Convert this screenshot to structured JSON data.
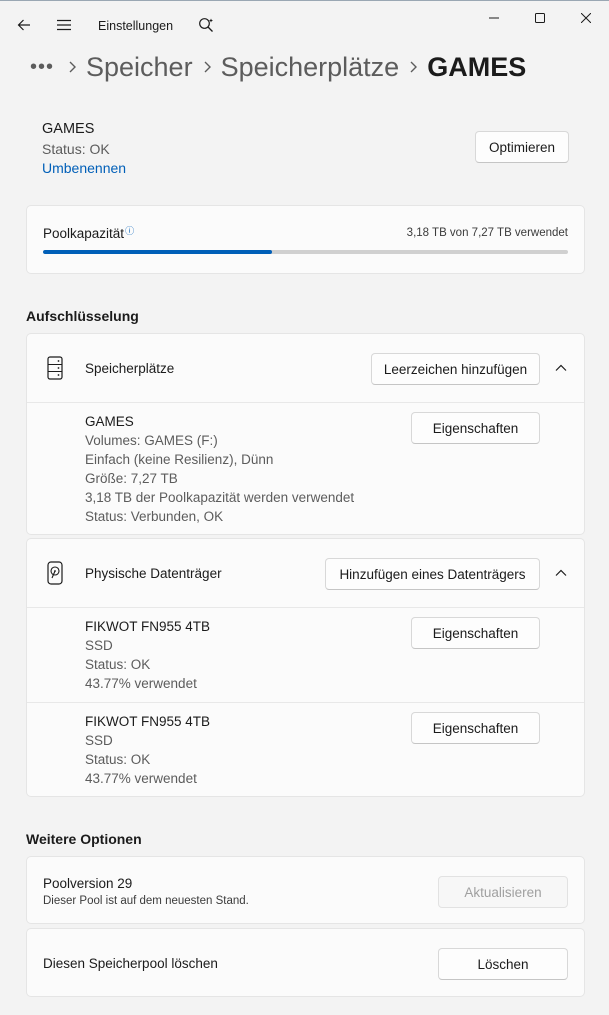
{
  "titlebar": {
    "app_title": "Einstellungen",
    "icons": {
      "back": "back-arrow-icon",
      "menu": "hamburger-menu-icon",
      "search": "search-icon",
      "minimize": "minimize-icon",
      "maximize": "maximize-icon",
      "close": "close-icon"
    }
  },
  "breadcrumb": {
    "more": "•••",
    "items": [
      "Speicher",
      "Speicherplätze"
    ],
    "current": "GAMES"
  },
  "pool": {
    "name": "GAMES",
    "status": "Status: OK",
    "rename_link": "Umbenennen",
    "optimize_button": "Optimieren"
  },
  "capacity": {
    "label": "Poolkapazität",
    "info_glyph": "ⓘ",
    "used_text": "3,18 TB von 7,27 TB verwendet",
    "used_fraction": 0.437,
    "accent_color": "#005fb8"
  },
  "breakdown": {
    "title": "Aufschlüsselung",
    "spaces": {
      "title": "Speicherplätze",
      "add_button": "Leerzeichen hinzufügen",
      "items": [
        {
          "lines": [
            "GAMES",
            "Volumes: GAMES (F:)",
            "Einfach (keine Resilienz), Dünn",
            "Größe: 7,27 TB",
            "3,18 TB der Poolkapazität werden verwendet",
            "Status: Verbunden, OK"
          ],
          "button": "Eigenschaften"
        }
      ]
    },
    "disks": {
      "title": "Physische Datenträger",
      "add_button": "Hinzufügen eines Datenträgers",
      "items": [
        {
          "lines": [
            "FIKWOT FN955 4TB",
            "SSD",
            "Status: OK",
            "43.77% verwendet"
          ],
          "button": "Eigenschaften"
        },
        {
          "lines": [
            "FIKWOT FN955 4TB",
            "SSD",
            "Status: OK",
            "43.77% verwendet"
          ],
          "button": "Eigenschaften"
        }
      ]
    }
  },
  "more_options": {
    "title": "Weitere Optionen",
    "version": {
      "title": "Poolversion 29",
      "subtitle": "Dieser Pool ist auf dem neuesten Stand.",
      "button": "Aktualisieren"
    },
    "delete": {
      "title": "Diesen Speicherpool löschen",
      "button": "Löschen"
    }
  }
}
